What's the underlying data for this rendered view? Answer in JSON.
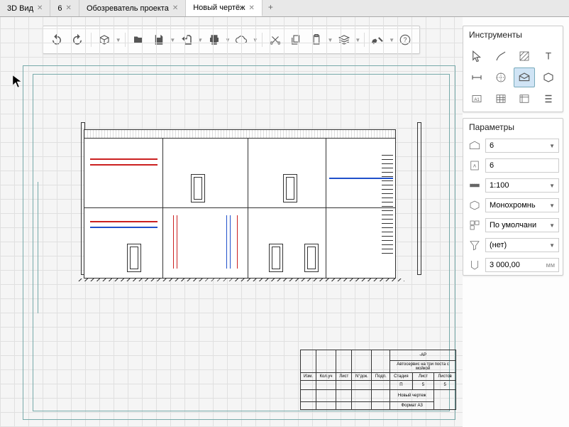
{
  "tabs": [
    {
      "label": "3D Вид"
    },
    {
      "label": "6"
    },
    {
      "label": "Обозреватель проекта"
    },
    {
      "label": "Новый чертёж",
      "active": true
    }
  ],
  "panels": {
    "tools_title": "Инструменты",
    "params_title": "Параметры"
  },
  "params": {
    "view_name": "6",
    "sheet_name": "6",
    "scale": "1:100",
    "color_mode": "Монохромнь",
    "detail": "По умолчани",
    "filter": "(нет)",
    "depth": "3 000,00",
    "depth_unit": "мм"
  },
  "titleblock": {
    "suffix": "-АР",
    "project": "Автосервис на три поста с мойкой",
    "col_stage": "Стадия",
    "col_sheet": "Лист",
    "col_sheets": "Листов",
    "stage": "П",
    "sheet": "5",
    "sheets": "5",
    "name": "Новый чертеж",
    "format": "Формат А3",
    "hdr_izm": "Изм.",
    "hdr_kol": "Кол.уч",
    "hdr_list": "Лист",
    "hdr_ndoc": "N°док.",
    "hdr_podp": "Подп."
  }
}
